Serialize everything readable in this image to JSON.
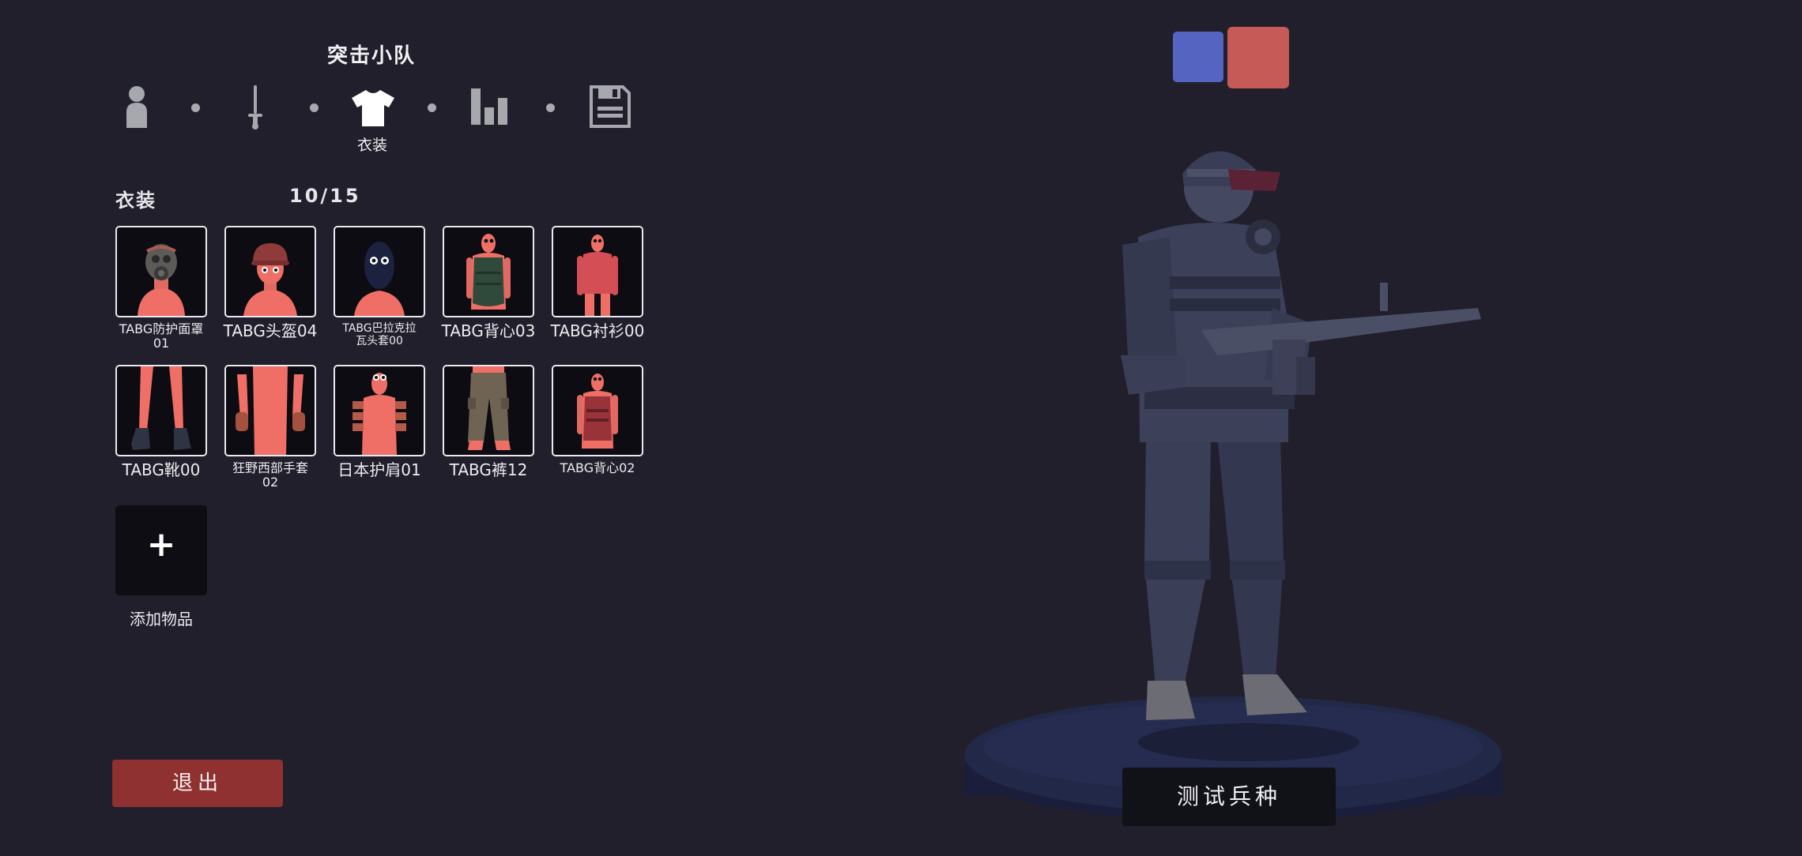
{
  "header": {
    "title": "突击小队"
  },
  "steps": {
    "items": [
      {
        "icon": "person-icon",
        "active": false
      },
      {
        "icon": "sword-icon",
        "active": false
      },
      {
        "icon": "shirt-icon",
        "active": true
      },
      {
        "icon": "bar-stats-icon",
        "active": false
      },
      {
        "icon": "save-icon",
        "active": false
      }
    ],
    "active_label": "衣装"
  },
  "section": {
    "title": "衣装",
    "count": "10/15"
  },
  "items": [
    {
      "label": "TABG防护面罩01",
      "label_l1": "TABG防护面罩",
      "label_l2": "01",
      "thumb": "gas-mask"
    },
    {
      "label": "TABG头盔04",
      "thumb": "helmet"
    },
    {
      "label": "TABG巴拉克拉瓦头套00",
      "label_l1": "TABG巴拉克拉",
      "label_l2": "瓦头套00",
      "thumb": "balaclava"
    },
    {
      "label": "TABG背心03",
      "thumb": "vest-green"
    },
    {
      "label": "TABG衬衫00",
      "thumb": "shirt"
    },
    {
      "label": "TABG靴00",
      "thumb": "boots"
    },
    {
      "label": "狂野西部手套02",
      "label_l1": "狂野西部手套",
      "label_l2": "02",
      "thumb": "gloves"
    },
    {
      "label": "日本护肩01",
      "thumb": "shoulder-guard"
    },
    {
      "label": "TABG裤12",
      "thumb": "pants"
    },
    {
      "label": "TABG背心02",
      "thumb": "vest-red"
    }
  ],
  "add_item": {
    "symbol": "+",
    "label": "添加物品"
  },
  "exit_button": {
    "label": "退出"
  },
  "team": {
    "blue": "#5563c1",
    "red": "#c55a56"
  },
  "test_button": {
    "label": "测试兵种"
  },
  "colors": {
    "background": "#201f2b",
    "exit": "#8f3131",
    "unit_skin": "#ef6f66"
  }
}
